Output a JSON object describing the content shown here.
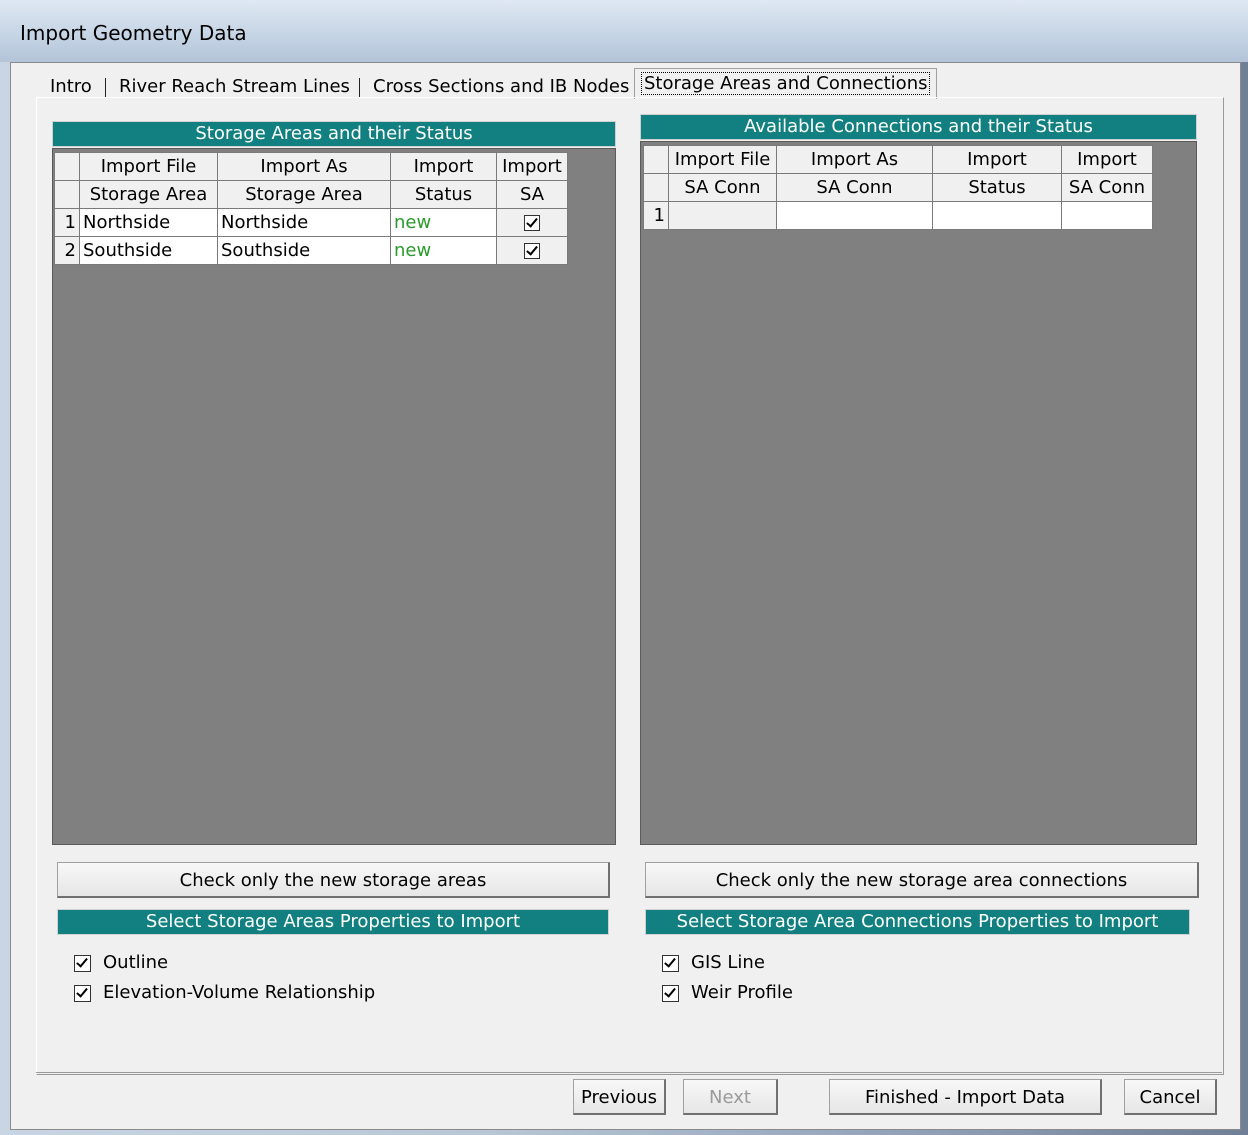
{
  "window": {
    "title": "Import Geometry Data"
  },
  "tabs": [
    {
      "label": "Intro"
    },
    {
      "label": "River Reach Stream Lines"
    },
    {
      "label": "Cross Sections and IB Nodes"
    },
    {
      "label": "Storage Areas and Connections"
    }
  ],
  "left": {
    "title": "Storage Areas and their Status",
    "headers_row1": [
      "Import File",
      "Import As",
      "Import",
      "Import"
    ],
    "headers_row2": [
      "Storage Area",
      "Storage Area",
      "Status",
      "SA"
    ],
    "rows": [
      {
        "num": "1",
        "import_file": "Northside",
        "import_as": "Northside",
        "status": "new",
        "checked": true
      },
      {
        "num": "2",
        "import_file": "Southside",
        "import_as": "Southside",
        "status": "new",
        "checked": true
      }
    ],
    "check_button": "Check only the new storage areas",
    "props_title": "Select Storage Areas Properties to Import",
    "options": [
      {
        "label": "Outline",
        "checked": true
      },
      {
        "label": "Elevation-Volume Relationship",
        "checked": true
      }
    ]
  },
  "right": {
    "title": "Available Connections and their Status",
    "headers_row1": [
      "Import File",
      "Import As",
      "Import",
      "Import"
    ],
    "headers_row2": [
      "SA Conn",
      "SA Conn",
      "Status",
      "SA Conn"
    ],
    "rows": [
      {
        "num": "1",
        "import_file": "",
        "import_as": "",
        "status": "",
        "sa_conn": ""
      }
    ],
    "check_button": "Check only the new storage area connections",
    "props_title": "Select Storage Area Connections Properties to Import",
    "options": [
      {
        "label": "GIS Line",
        "checked": true
      },
      {
        "label": "Weir Profile",
        "checked": true
      }
    ]
  },
  "footer": {
    "previous": "Previous",
    "next": "Next",
    "finish": "Finished - Import Data",
    "cancel": "Cancel"
  },
  "colors": {
    "section_bar": "#128080",
    "status_new": "#2a9a2a",
    "grid_bg": "#808080"
  }
}
